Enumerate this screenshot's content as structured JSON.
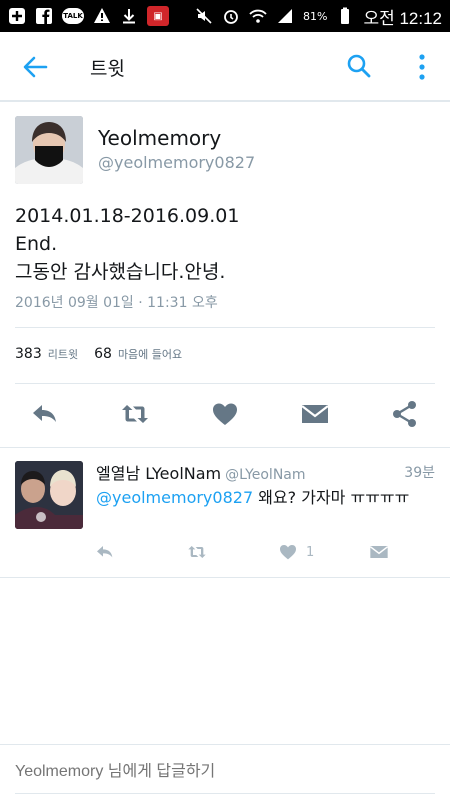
{
  "statusbar": {
    "talk_label": "TALK",
    "battery_pct": "81%",
    "time": "오전 12:12"
  },
  "appbar": {
    "title": "트윗"
  },
  "tweet": {
    "name": "Yeolmemory",
    "handle": "@yeolmemory0827",
    "text_lines": [
      "2014.01.18-2016.09.01",
      "End.",
      "그동안 감사했습니다.안녕."
    ],
    "timestamp": "2016년 09월 01일 · 11:31 오후",
    "retweet_count": "383",
    "retweet_label": "리트윗",
    "like_count": "68",
    "like_label": "마음에 들어요"
  },
  "reply": {
    "name": "엘열남 LYeolNam",
    "handle": "@LYeolNam",
    "age": "39분",
    "mention": "@yeolmemory0827",
    "text": " 왜요? 가자마 ㅠㅠㅠㅠ",
    "like_count": "1"
  },
  "compose": {
    "placeholder": "Yeolmemory 님에게 답글하기"
  },
  "colors": {
    "accent": "#1da1f2",
    "icon_gray": "#657786",
    "muted": "#8899a6",
    "divider": "#e1e8ed"
  }
}
